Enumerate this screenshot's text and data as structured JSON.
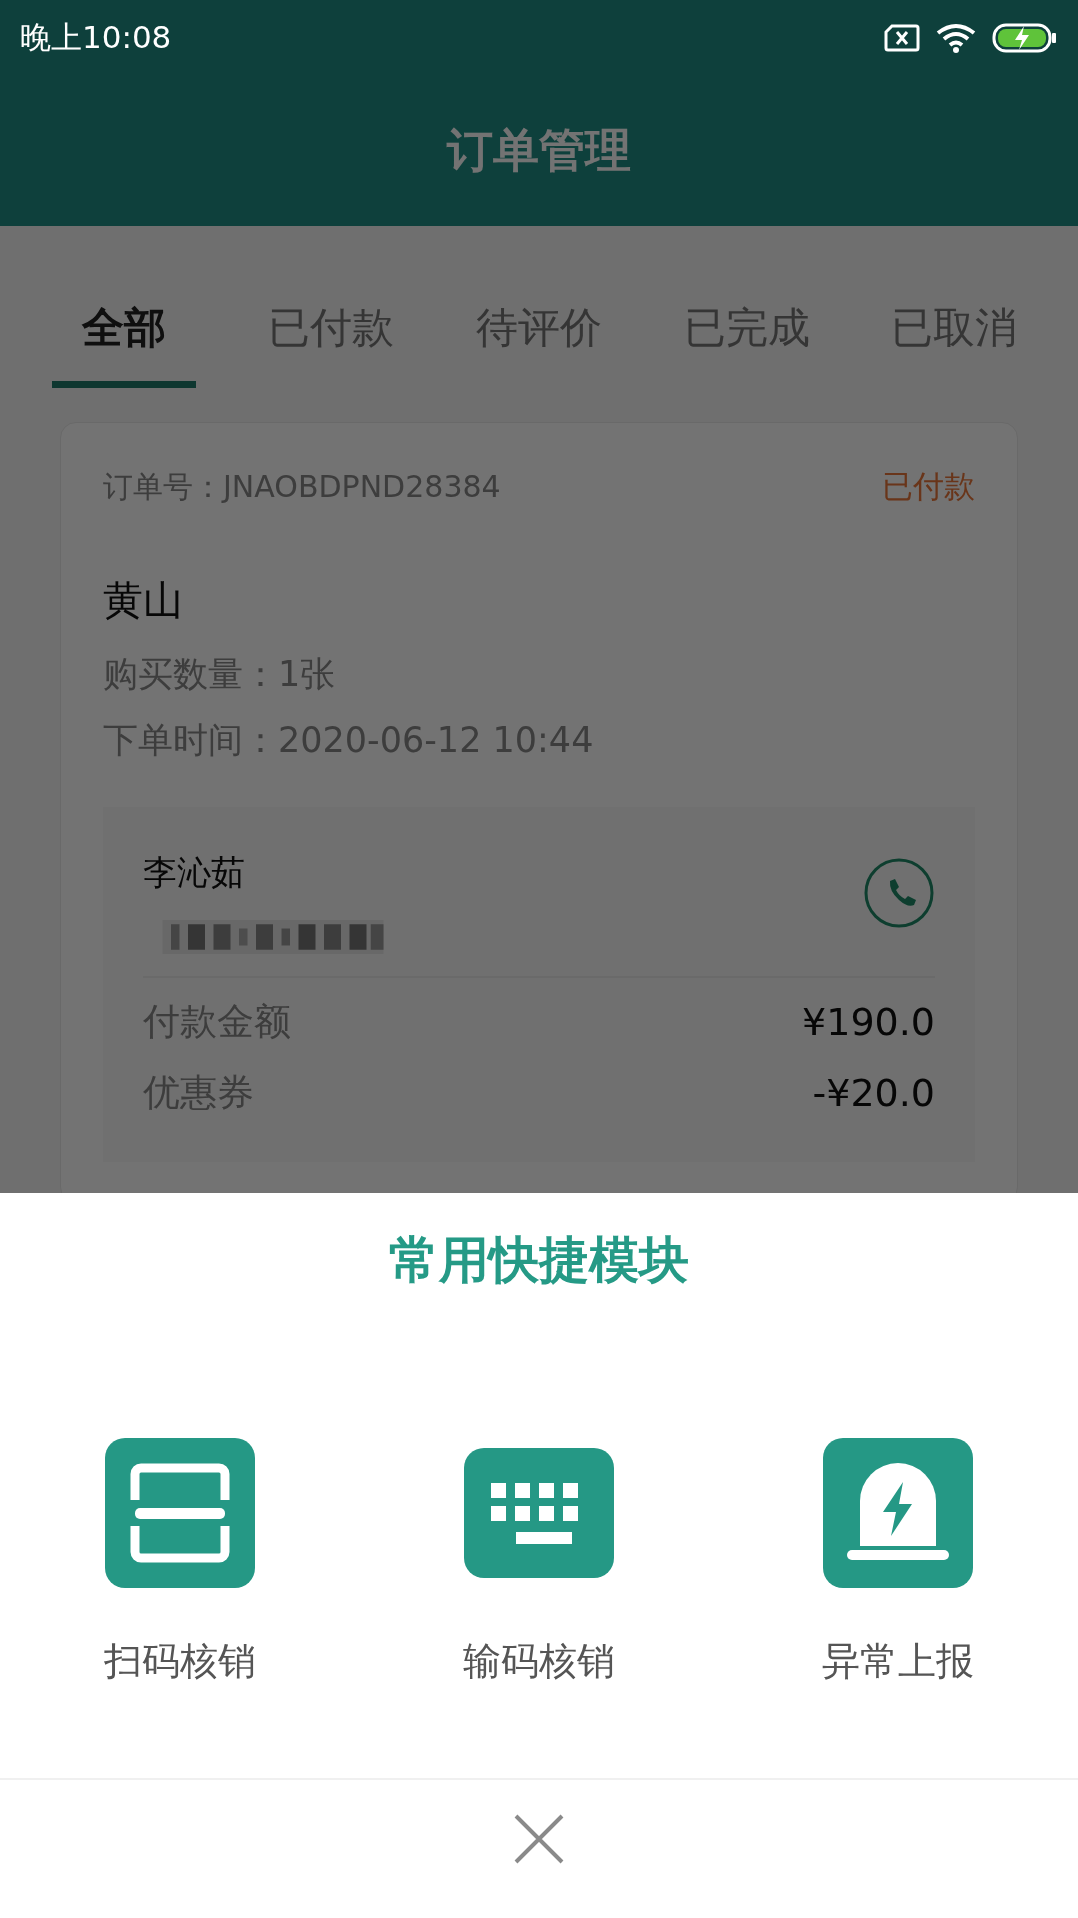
{
  "status_bar": {
    "time": "晚上10:08"
  },
  "header": {
    "title": "订单管理"
  },
  "tabs": [
    {
      "label": "全部",
      "selected": true
    },
    {
      "label": "已付款",
      "selected": false
    },
    {
      "label": "待评价",
      "selected": false
    },
    {
      "label": "已完成",
      "selected": false
    },
    {
      "label": "已取消",
      "selected": false
    }
  ],
  "order": {
    "order_no": "订单号：JNAOBDPND28384",
    "status": "已付款",
    "title": "黄山",
    "quantity": "购买数量：1张",
    "order_time": "下单时间：2020-06-12 10:44",
    "contact_name": "李沁茹",
    "amounts": [
      {
        "label": "付款金额",
        "value": "¥190.0"
      },
      {
        "label": "优惠券",
        "value": "-¥20.0"
      }
    ]
  },
  "sheet": {
    "title": "常用快捷模块",
    "actions": [
      {
        "kind": "scan",
        "label": "扫码核销"
      },
      {
        "kind": "keyboard",
        "label": "输码核销"
      },
      {
        "kind": "alarm",
        "label": "异常上报"
      }
    ]
  }
}
